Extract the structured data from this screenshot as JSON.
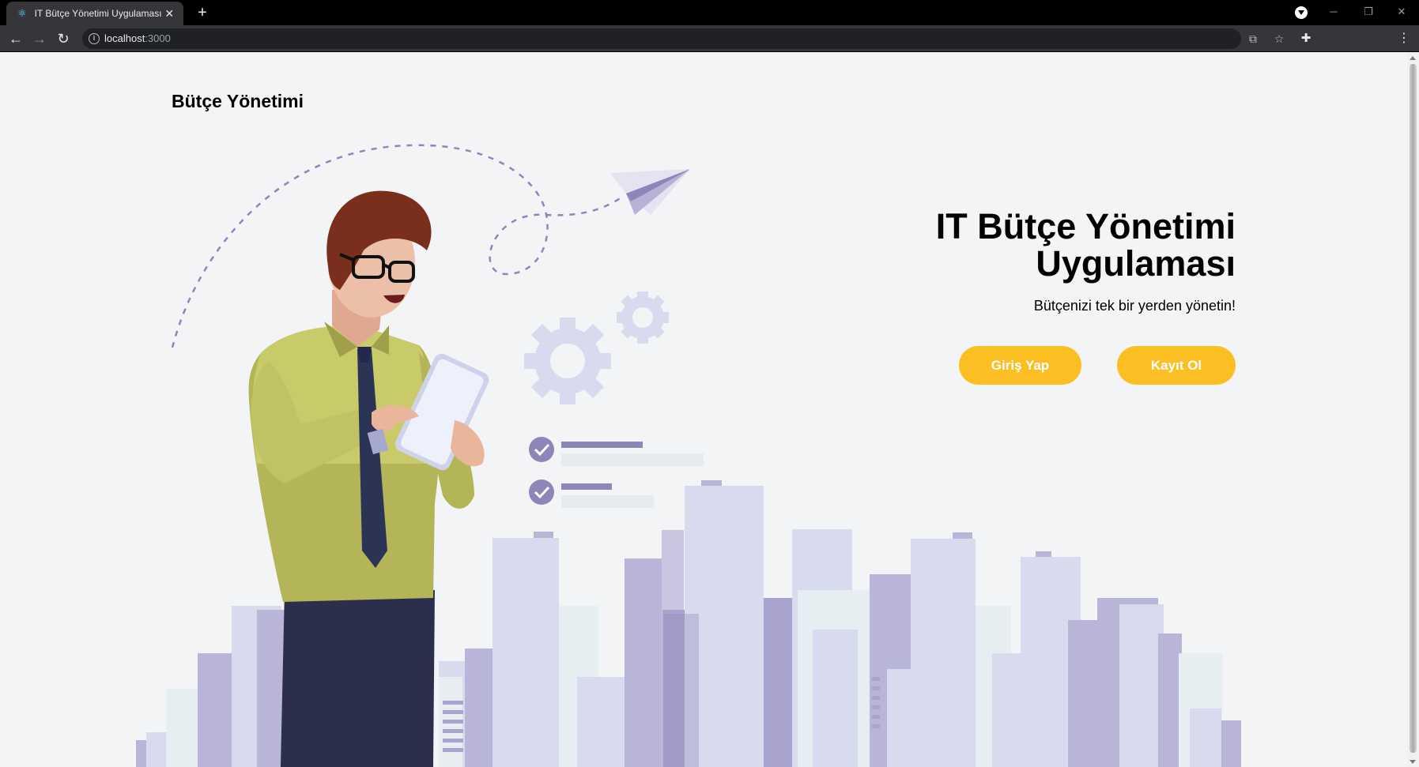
{
  "browser": {
    "tab_title": "IT Bütçe Yönetimi Uygulaması",
    "url_host": "localhost",
    "url_port": ":3000"
  },
  "page": {
    "brand": "Bütçe Yönetimi",
    "hero_title": "IT Bütçe Yönetimi Uygulaması",
    "hero_subtitle": "Bütçenizi tek bir yerden yönetin!",
    "login_button": "Giriş Yap",
    "register_button": "Kayıt Ol"
  },
  "colors": {
    "accent": "#fbbf24",
    "background": "#f3f4f6",
    "illustration_purple": "#8c87b8",
    "building_light": "#d8dbee"
  },
  "icons": [
    "react-favicon",
    "close-icon",
    "plus-icon",
    "back-arrow-icon",
    "forward-arrow-icon",
    "reload-icon",
    "info-icon",
    "translate-icon",
    "star-icon",
    "puzzle-icon",
    "more-vert-icon",
    "check-circle-icon",
    "gear-icon",
    "paper-plane-icon"
  ]
}
